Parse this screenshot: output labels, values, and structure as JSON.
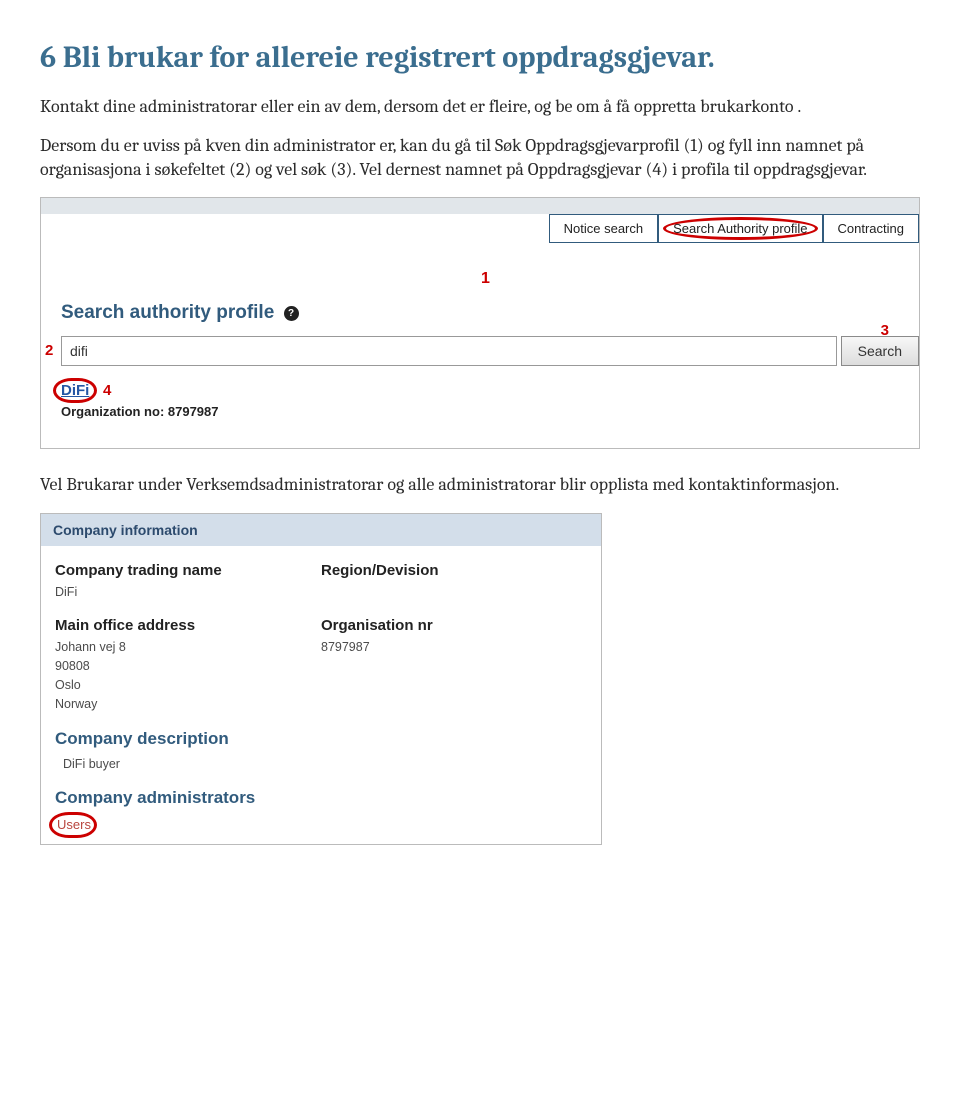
{
  "heading": "6  Bli brukar for allereie registrert oppdragsgjevar.",
  "para1": "Kontakt dine administratorar eller ein av dem, dersom det er fleire, og be om å få oppretta brukarkonto .",
  "para2": "Dersom du  er uviss på kven din administrator er, kan du gå til Søk Oppdragsgjevarprofil (1) og fyll inn namnet på organisasjona i søkefeltet (2) og vel søk (3). Vel dernest namnet på Oppdragsgjevar (4) i profila til oppdragsgjevar.",
  "screenshot1": {
    "tabs": {
      "notice": "Notice search",
      "authority": "Search Authority profile",
      "contracting": "Contracting"
    },
    "section_title": "Search authority profile",
    "help_icon": "?",
    "input_value": "difi",
    "search_btn": "Search",
    "result_name": "DiFi",
    "org_no_label": "Organization no: 8797987",
    "callouts": {
      "c1": "1",
      "c2": "2",
      "c3": "3",
      "c4": "4"
    }
  },
  "para3": "Vel Brukarar under Verksemdsadministratorar og alle administratorar blir opplista med kontaktinformasjon.",
  "screenshot2": {
    "header": "Company information",
    "trading_name_label": "Company trading name",
    "trading_name_value": "DiFi",
    "region_label": "Region/Devision",
    "address_label": "Main office address",
    "address_lines": [
      "Johann vej 8",
      "90808",
      "Oslo",
      "Norway"
    ],
    "orgnr_label": "Organisation nr",
    "orgnr_value": "8797987",
    "description_heading": "Company description",
    "description_value": "DiFi buyer",
    "admins_heading": "Company administrators",
    "users_link": "Users"
  }
}
